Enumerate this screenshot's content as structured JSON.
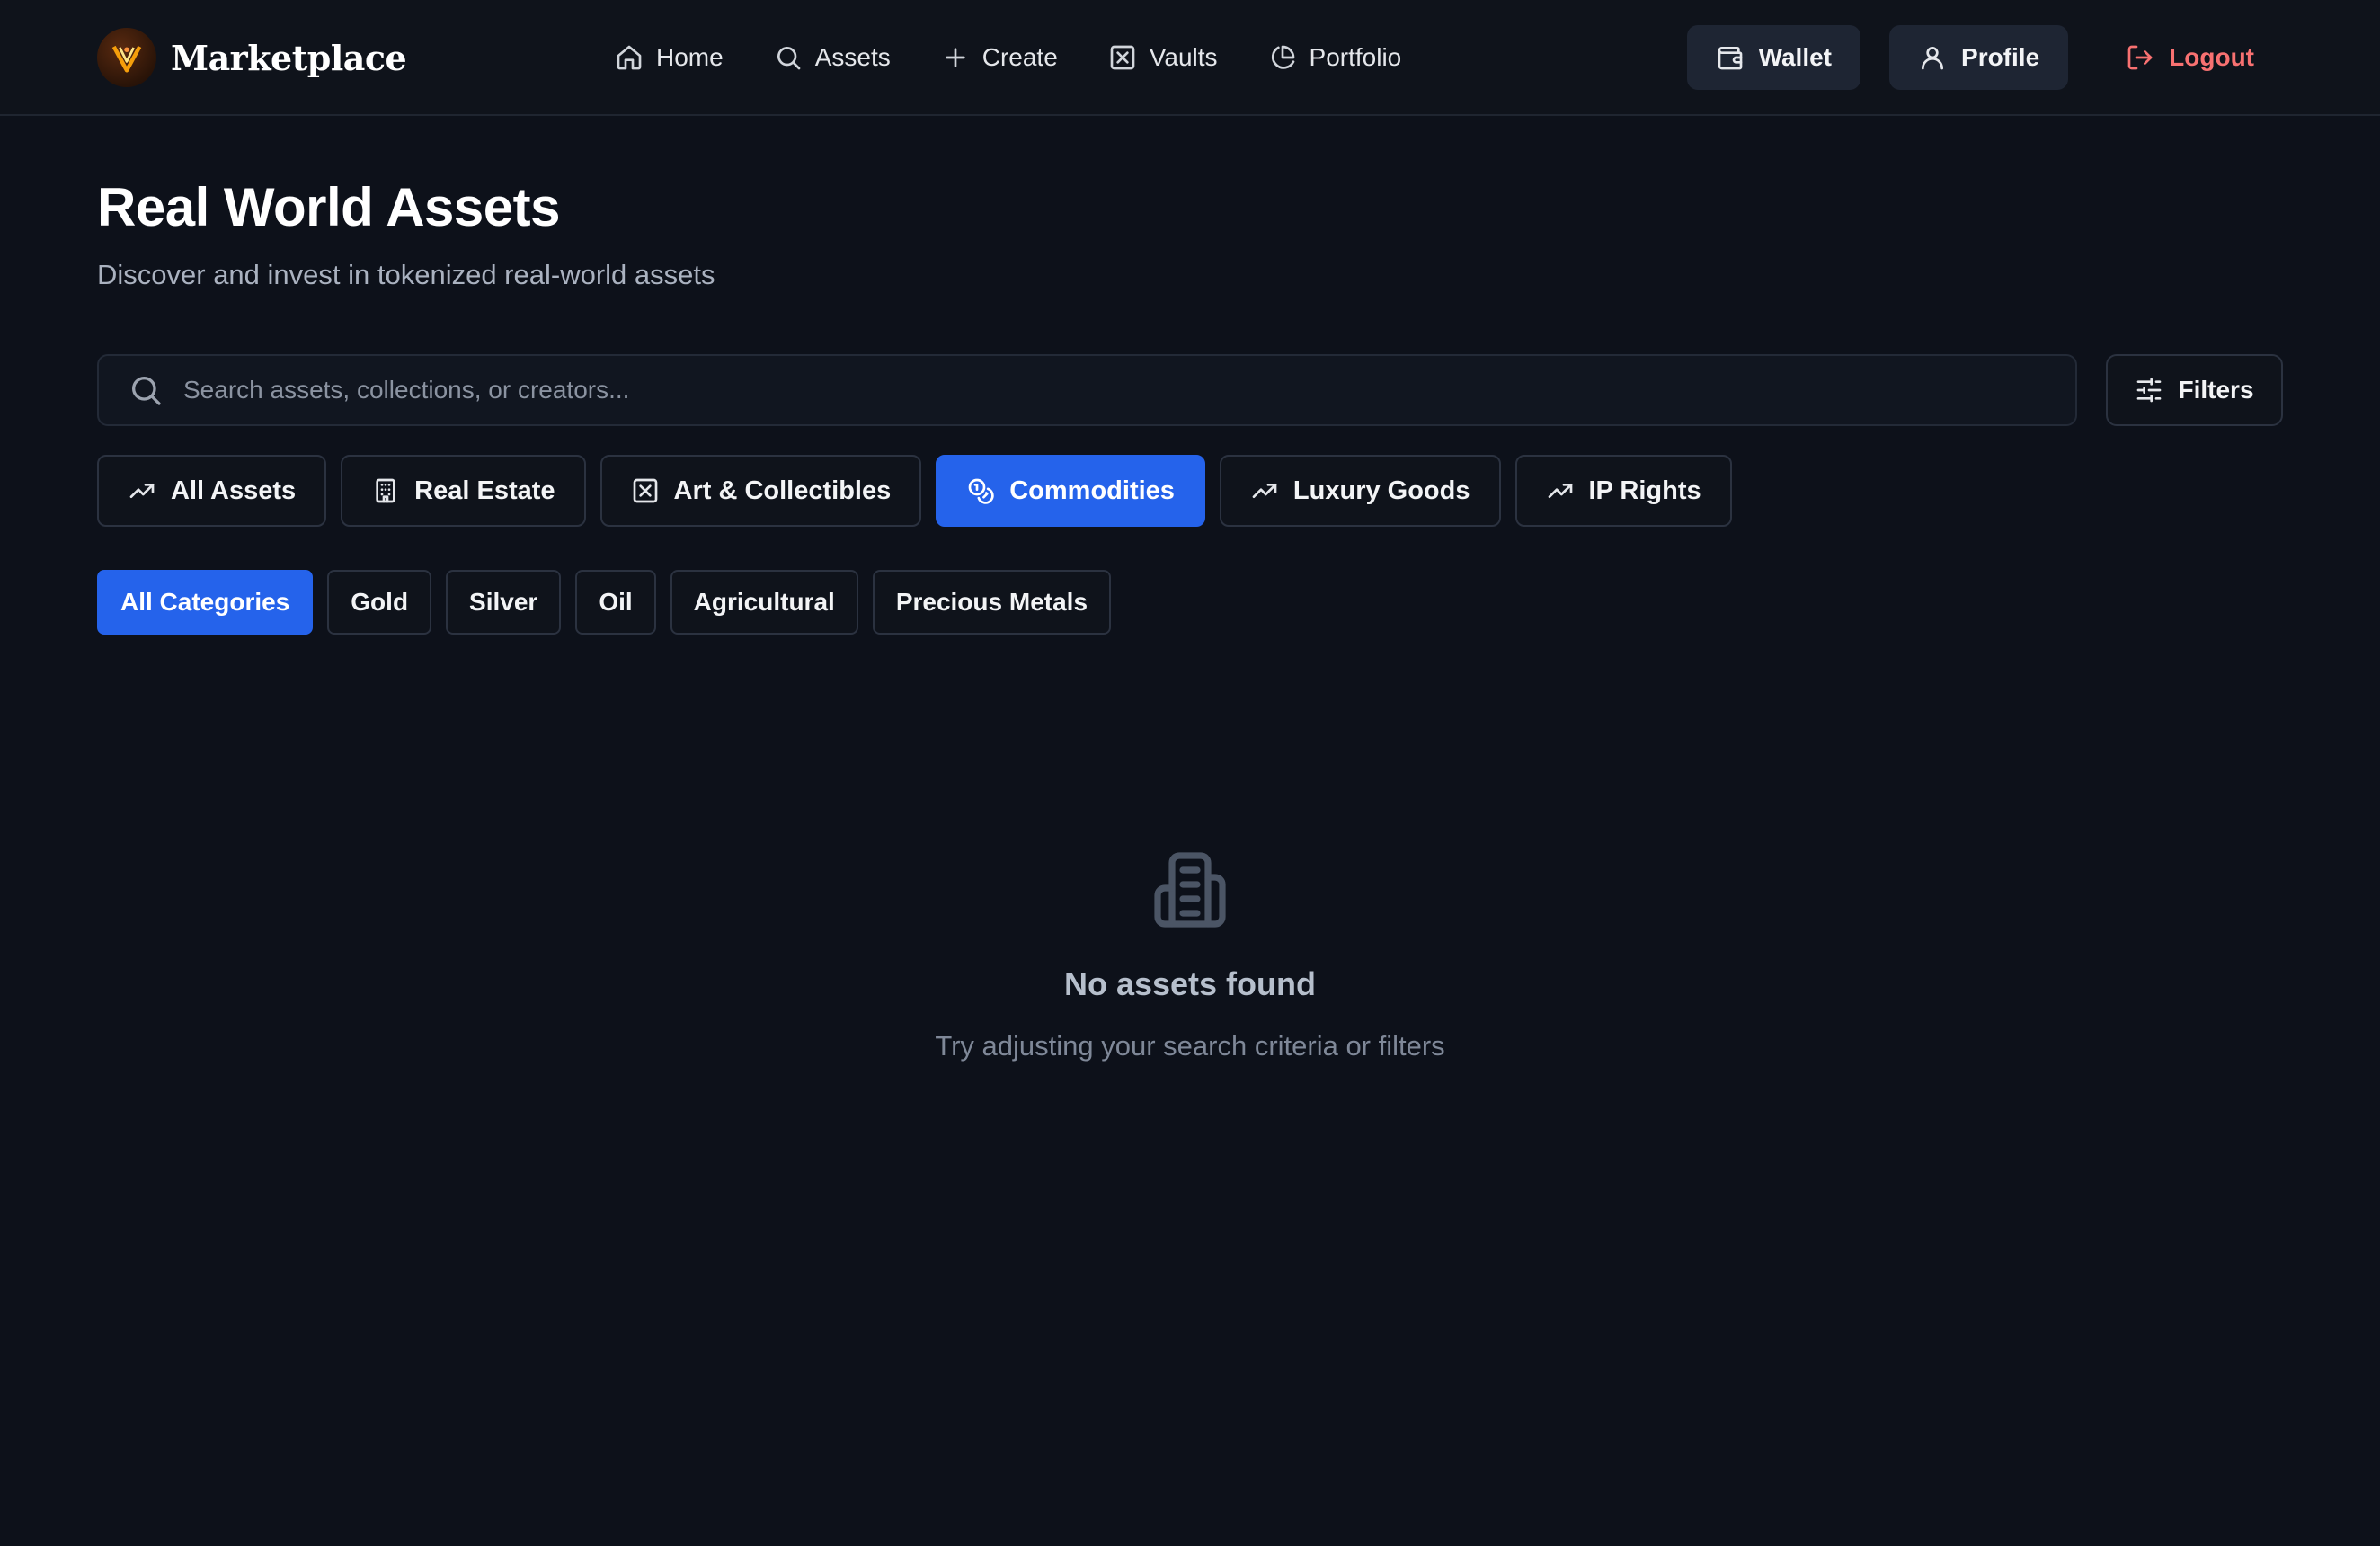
{
  "app": {
    "brand_name": "Marketplace",
    "accent_color": "#2563eb",
    "logout_color": "#f87171"
  },
  "nav": {
    "items": [
      {
        "label": "Home",
        "icon": "home-icon"
      },
      {
        "label": "Assets",
        "icon": "search-icon"
      },
      {
        "label": "Create",
        "icon": "plus-icon"
      },
      {
        "label": "Vaults",
        "icon": "vault-icon"
      },
      {
        "label": "Portfolio",
        "icon": "pie-chart-icon"
      }
    ]
  },
  "top_actions": {
    "wallet_label": "Wallet",
    "profile_label": "Profile",
    "logout_label": "Logout"
  },
  "header": {
    "title": "Real World Assets",
    "subtitle": "Discover and invest in tokenized real-world assets"
  },
  "search": {
    "placeholder": "Search assets, collections, or creators...",
    "value": ""
  },
  "filters_label": "Filters",
  "asset_types": [
    {
      "label": "All Assets",
      "icon": "trending-up-icon",
      "active": false
    },
    {
      "label": "Real Estate",
      "icon": "building-icon",
      "active": false
    },
    {
      "label": "Art & Collectibles",
      "icon": "art-icon",
      "active": false
    },
    {
      "label": "Commodities",
      "icon": "coins-icon",
      "active": true
    },
    {
      "label": "Luxury Goods",
      "icon": "trending-up-icon",
      "active": false
    },
    {
      "label": "IP Rights",
      "icon": "trending-up-icon",
      "active": false
    }
  ],
  "categories": [
    {
      "label": "All Categories",
      "active": true
    },
    {
      "label": "Gold",
      "active": false
    },
    {
      "label": "Silver",
      "active": false
    },
    {
      "label": "Oil",
      "active": false
    },
    {
      "label": "Agricultural",
      "active": false
    },
    {
      "label": "Precious Metals",
      "active": false
    }
  ],
  "empty_state": {
    "icon": "building-icon",
    "title": "No assets found",
    "message": "Try adjusting your search criteria or filters"
  }
}
